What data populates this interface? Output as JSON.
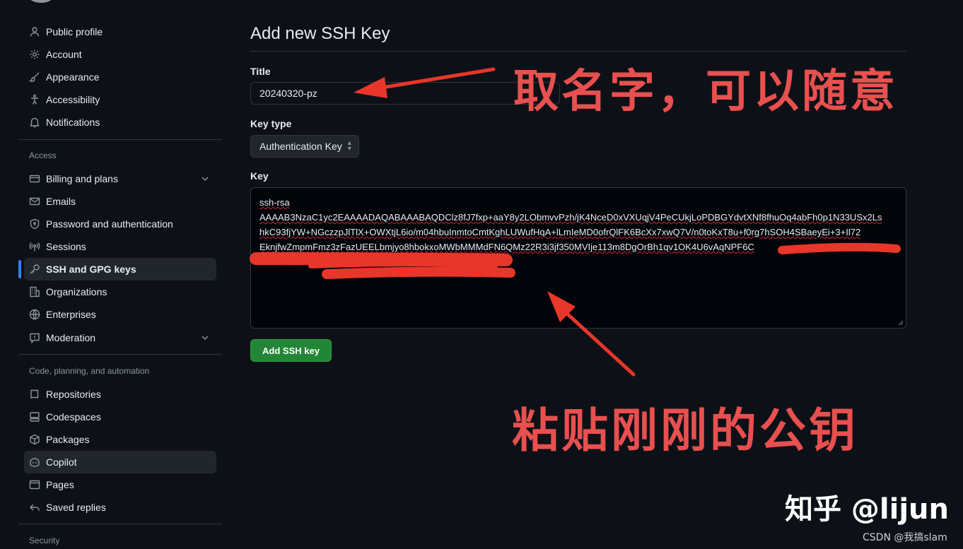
{
  "sidebar": {
    "top_items": [
      {
        "label": "Public profile",
        "icon": "person-icon"
      },
      {
        "label": "Account",
        "icon": "gear-icon"
      },
      {
        "label": "Appearance",
        "icon": "paintbrush-icon"
      },
      {
        "label": "Accessibility",
        "icon": "accessibility-icon"
      },
      {
        "label": "Notifications",
        "icon": "bell-icon"
      }
    ],
    "access_heading": "Access",
    "access_items": [
      {
        "label": "Billing and plans",
        "icon": "credit-card-icon",
        "expandable": true
      },
      {
        "label": "Emails",
        "icon": "mail-icon"
      },
      {
        "label": "Password and authentication",
        "icon": "shield-lock-icon"
      },
      {
        "label": "Sessions",
        "icon": "broadcast-icon"
      },
      {
        "label": "SSH and GPG keys",
        "icon": "key-icon",
        "active": true
      },
      {
        "label": "Organizations",
        "icon": "organization-icon"
      },
      {
        "label": "Enterprises",
        "icon": "globe-icon"
      },
      {
        "label": "Moderation",
        "icon": "report-icon",
        "expandable": true
      }
    ],
    "code_heading": "Code, planning, and automation",
    "code_items": [
      {
        "label": "Repositories",
        "icon": "repo-icon"
      },
      {
        "label": "Codespaces",
        "icon": "codespaces-icon"
      },
      {
        "label": "Packages",
        "icon": "package-icon"
      },
      {
        "label": "Copilot",
        "icon": "copilot-icon",
        "highlighted": true
      },
      {
        "label": "Pages",
        "icon": "browser-icon"
      },
      {
        "label": "Saved replies",
        "icon": "reply-icon"
      }
    ],
    "security_heading": "Security"
  },
  "main": {
    "title": "Add new SSH Key",
    "title_field_label": "Title",
    "title_field_value": "20240320-pz",
    "key_type_label": "Key type",
    "key_type_value": "Authentication Key",
    "key_label": "Key",
    "key_lines": [
      "ssh-rsa",
      "AAAAB3NzaC1yc2EAAAADAQABAAABAQDClz8fJ7fxp+aaY8y2LObmvvPzh/jK4NceD0xVXUqjV4PeCUkjLoPDBGYdvtXNf8fhuOq4abFh0p1N33USx2Ls",
      "hkC93fjYW+NGczzpJlTlX+OWXtjL6io/m04hbuInmtoCmtKghLUWufHqA+lLmIeMD0ofrQlFK6BcXx7xwQ7V/n0toKxT8u+f0rg7hSOH4SBaeyEi+3+Il72",
      "EknjfwZmpmFmz3zFazUEELbmjyo8hbokxoMWbMMMdFN6QMz22R3i3jf350MVIje113m8DgOrBh1qv1OK4U6vAqNPF6C"
    ],
    "add_button_label": "Add SSH key"
  },
  "annotations": {
    "title_note": "取名字，可以随意",
    "key_note": "粘贴刚刚的公钥",
    "annotation_color": "#e8504f"
  },
  "watermark": "知乎 @lijun",
  "source_credit": "CSDN @我搞slam",
  "colors": {
    "accent": "#2f81f7",
    "button_green": "#238636",
    "background": "#0d1117",
    "redaction": "#e8362b"
  }
}
